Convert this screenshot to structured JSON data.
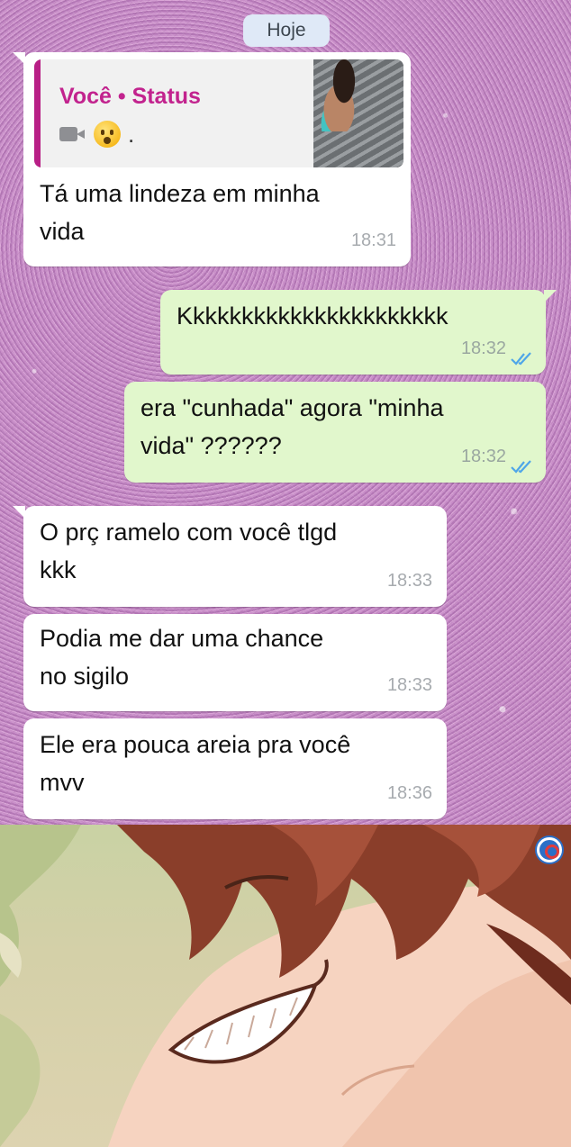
{
  "date_chip": "Hoje",
  "messages": [
    {
      "direction": "in",
      "quote": {
        "title": "Você • Status",
        "trailing": "."
      },
      "lines": [
        "Tá uma lindeza em minha",
        "vida"
      ],
      "time": "18:31"
    },
    {
      "direction": "out",
      "lines": [
        "Kkkkkkkkkkkkkkkkkkkkkk"
      ],
      "time": "18:32",
      "read": true
    },
    {
      "direction": "out",
      "lines": [
        "era \"cunhada\" agora \"minha",
        "vida\" ??????"
      ],
      "time": "18:32",
      "read": true
    },
    {
      "direction": "in",
      "lines": [
        "O prç ramelo com você tlgd",
        "kkk"
      ],
      "time": "18:33"
    },
    {
      "direction": "in",
      "lines": [
        "Podia me dar uma chance",
        "no sigilo"
      ],
      "time": "18:33"
    },
    {
      "direction": "in",
      "lines": [
        "Ele era pouca areia pra você",
        "mvv"
      ],
      "time": "18:36"
    }
  ],
  "icons": {
    "quote_media": "video-camera-icon",
    "quote_emoji": "hushed-face-emoji-icon",
    "read_receipt": "double-check-icon",
    "watermark": "logo-icon"
  },
  "colors": {
    "incoming_bubble": "#ffffff",
    "outgoing_bubble": "#e1f7cc",
    "quote_accent": "#c2238e",
    "read_ticks": "#4fa6e8"
  }
}
